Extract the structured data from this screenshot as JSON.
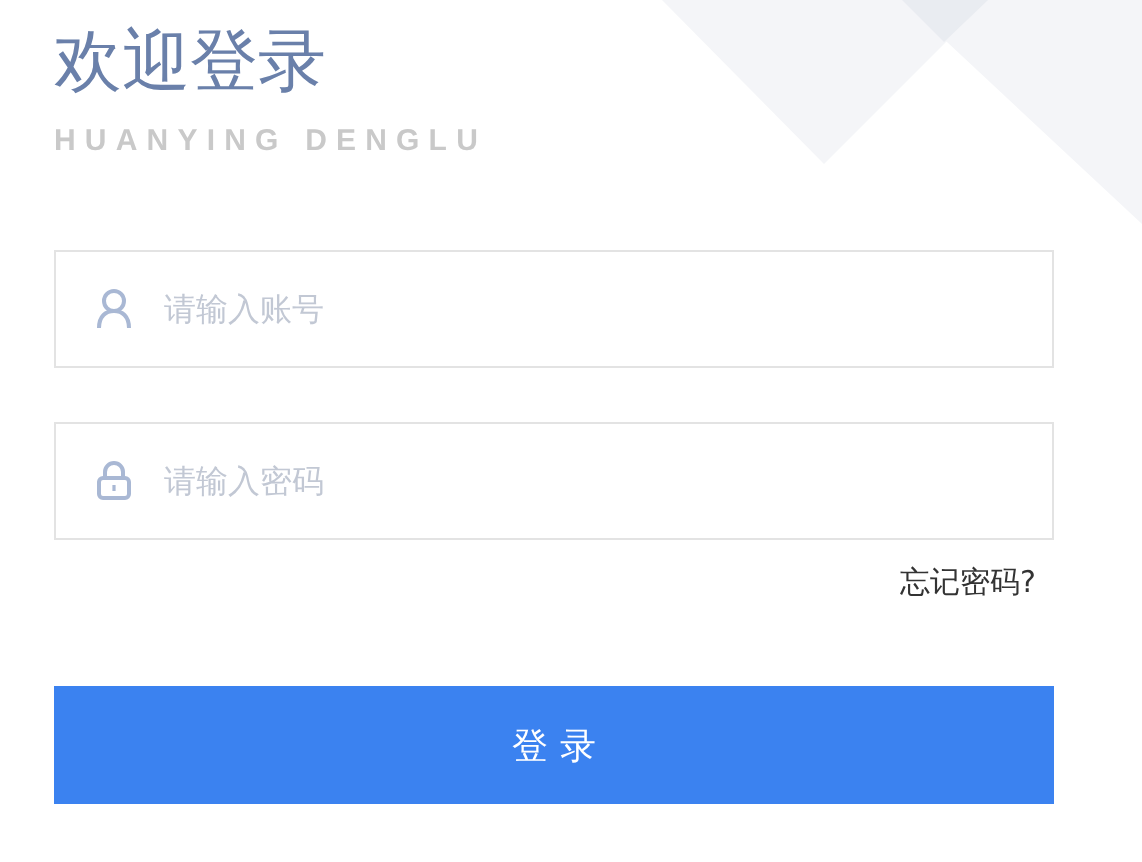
{
  "title": "欢迎登录",
  "subtitle": "HUANYING DENGLU",
  "fields": [
    {
      "kind": "account",
      "placeholder": "请输入账号"
    },
    {
      "kind": "password",
      "placeholder": "请输入密码"
    }
  ],
  "forgot_link": "忘记密码?",
  "login_button": "登 录"
}
